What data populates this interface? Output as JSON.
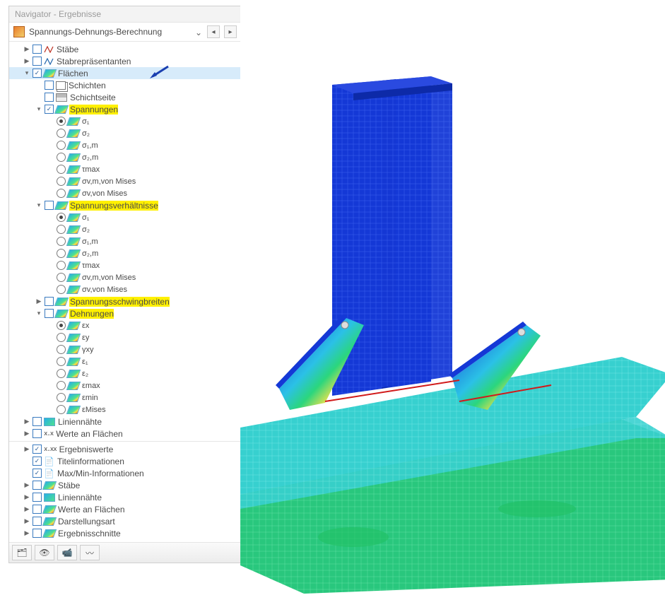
{
  "panel": {
    "title": "Navigator - Ergebnisse",
    "dropdown": "Spannungs-Dehnungs-Berechnung"
  },
  "tree1": {
    "staebe": "Stäbe",
    "stabrep": "Stabrepräsentanten",
    "flaechen": "Flächen",
    "schichten": "Schichten",
    "schichtseite": "Schichtseite",
    "spannungen": "Spannungen",
    "sp": {
      "s1": "σ₁",
      "s2": "σ₂",
      "s1m": "σ₁,m",
      "s2m": "σ₂,m",
      "tmax": "τmax",
      "svmm": "σv,m,von Mises",
      "svm": "σv,von Mises"
    },
    "spverh": "Spannungsverhältnisse",
    "schwing": "Spannungsschwingbreiten",
    "dehnungen": "Dehnungen",
    "de": {
      "ex": "εx",
      "ey": "εy",
      "gxy": "γxy",
      "e1": "ε₁",
      "e2": "ε₂",
      "emax": "εmax",
      "emin": "εmin",
      "emises": "εMises"
    },
    "liniennaehte": "Liniennähte",
    "werte_fl": "Werte an Flächen"
  },
  "tree2": {
    "ergwerte": "Ergebniswerte",
    "titel": "Titelinformationen",
    "maxmin": "Max/Min-Informationen",
    "staebe": "Stäbe",
    "liniennaehte": "Liniennähte",
    "werte_fl": "Werte an Flächen",
    "darst": "Darstellungsart",
    "schnitte": "Ergebnisschnitte"
  }
}
